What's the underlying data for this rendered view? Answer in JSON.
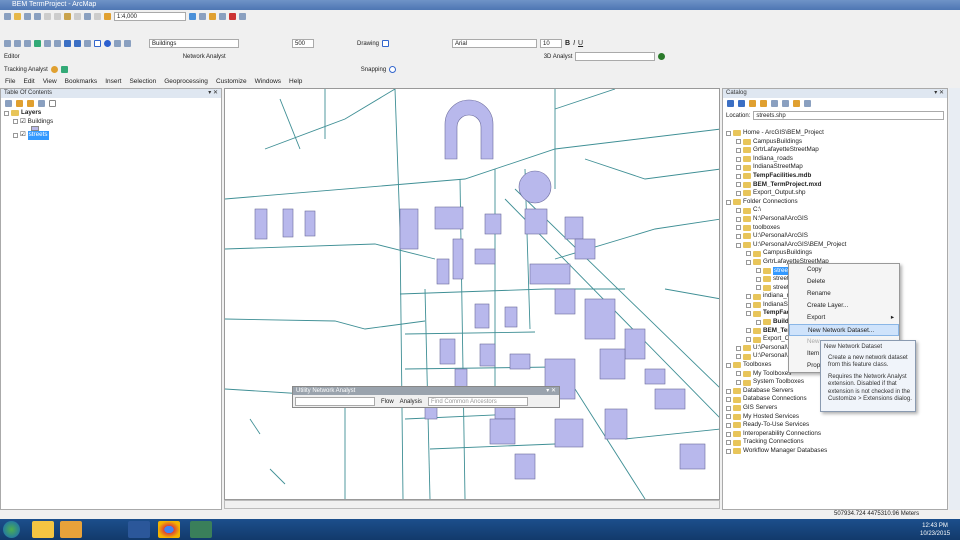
{
  "window": {
    "title": "BEM TermProject - ArcMap"
  },
  "toolbars": {
    "scale": "1:4,000",
    "layer_combo": "Buildings",
    "zoom_value": "500",
    "editor": "Editor",
    "network_analyst": "Network Analyst",
    "tracking_analyst": "Tracking Analyst",
    "snapping": "Snapping",
    "drawing": "Drawing",
    "font": "Arial",
    "font_size": "10",
    "analyst_3d": "3D Analyst"
  },
  "menu": [
    "File",
    "Edit",
    "View",
    "Bookmarks",
    "Insert",
    "Selection",
    "Geoprocessing",
    "Customize",
    "Windows",
    "Help"
  ],
  "toc": {
    "title": "Table Of Contents",
    "layers_label": "Layers",
    "items": [
      {
        "label": "Buildings"
      },
      {
        "label": "streets"
      }
    ]
  },
  "catalog": {
    "title": "Catalog",
    "location_label": "Location:",
    "location_value": "streets.shp",
    "tree": [
      {
        "label": "Home - ArcGIS\\BEM_Project",
        "level": 0,
        "bold": false
      },
      {
        "label": "CampusBuildings",
        "level": 1
      },
      {
        "label": "GrtrLafayetteStreetMap",
        "level": 1
      },
      {
        "label": "Indiana_roads",
        "level": 1
      },
      {
        "label": "IndianaStreetMap",
        "level": 1
      },
      {
        "label": "TempFacilities.mdb",
        "level": 1,
        "bold": true
      },
      {
        "label": "BEM_TermProject.mxd",
        "level": 1,
        "bold": true
      },
      {
        "label": "Export_Output.shp",
        "level": 1
      },
      {
        "label": "Folder Connections",
        "level": 0
      },
      {
        "label": "C:\\",
        "level": 1
      },
      {
        "label": "N:\\Personal\\ArcGIS",
        "level": 1
      },
      {
        "label": "toolboxes",
        "level": 1
      },
      {
        "label": "U:\\Personal\\ArcGIS",
        "level": 1
      },
      {
        "label": "U:\\Personal\\ArcGIS\\BEM_Project",
        "level": 1
      },
      {
        "label": "CampusBuildings",
        "level": 2
      },
      {
        "label": "GrtrLafayetteStreetMap",
        "level": 2
      },
      {
        "label": "streets",
        "level": 3,
        "selected": true
      },
      {
        "label": "streets",
        "level": 3
      },
      {
        "label": "streets",
        "level": 3
      },
      {
        "label": "indiana_r",
        "level": 2
      },
      {
        "label": "IndianaSt",
        "level": 2
      },
      {
        "label": "TempFac",
        "level": 2,
        "bold": true
      },
      {
        "label": "Buildi",
        "level": 3,
        "bold": true
      },
      {
        "label": "BEM_Ter",
        "level": 2,
        "bold": true
      },
      {
        "label": "Export_Ou",
        "level": 2
      },
      {
        "label": "U:\\Personal\\",
        "level": 1
      },
      {
        "label": "U:\\Personal\\",
        "level": 1
      },
      {
        "label": "Toolboxes",
        "level": 0
      },
      {
        "label": "My Toolboxes",
        "level": 1
      },
      {
        "label": "System Toolboxes",
        "level": 1
      },
      {
        "label": "Database Servers",
        "level": 0
      },
      {
        "label": "Database Connections",
        "level": 0
      },
      {
        "label": "GIS Servers",
        "level": 0
      },
      {
        "label": "My Hosted Services",
        "level": 0
      },
      {
        "label": "Ready-To-Use Services",
        "level": 0
      },
      {
        "label": "Interoperability Connections",
        "level": 0
      },
      {
        "label": "Tracking Connections",
        "level": 0
      },
      {
        "label": "Workflow Manager Databases",
        "level": 0
      }
    ]
  },
  "context_menu": [
    {
      "label": "Copy"
    },
    {
      "label": "Delete"
    },
    {
      "label": "Rename"
    },
    {
      "label": "Create Layer..."
    },
    {
      "label": "Export",
      "submenu": true
    },
    {
      "label": "New Network Dataset...",
      "highlighted": true
    },
    {
      "label": "New ...",
      "disabled": true
    },
    {
      "label": "Item ..."
    },
    {
      "label": "Properties..."
    }
  ],
  "tooltip": {
    "title": "New Network Dataset",
    "line1": "Create a new network dataset from this feature class.",
    "line2": "Requires the Network Analyst extension. Disabled if that extension is not checked in the Customize > Extensions dialog."
  },
  "utility_network": {
    "title": "Utility Network Analyst",
    "flow": "Flow",
    "analysis": "Analysis",
    "task": "Find Common Ancestors"
  },
  "status": {
    "coords": "507934.724  4475310.96 Meters"
  },
  "taskbar": {
    "time": "12:43 PM",
    "date": "10/23/2015"
  }
}
